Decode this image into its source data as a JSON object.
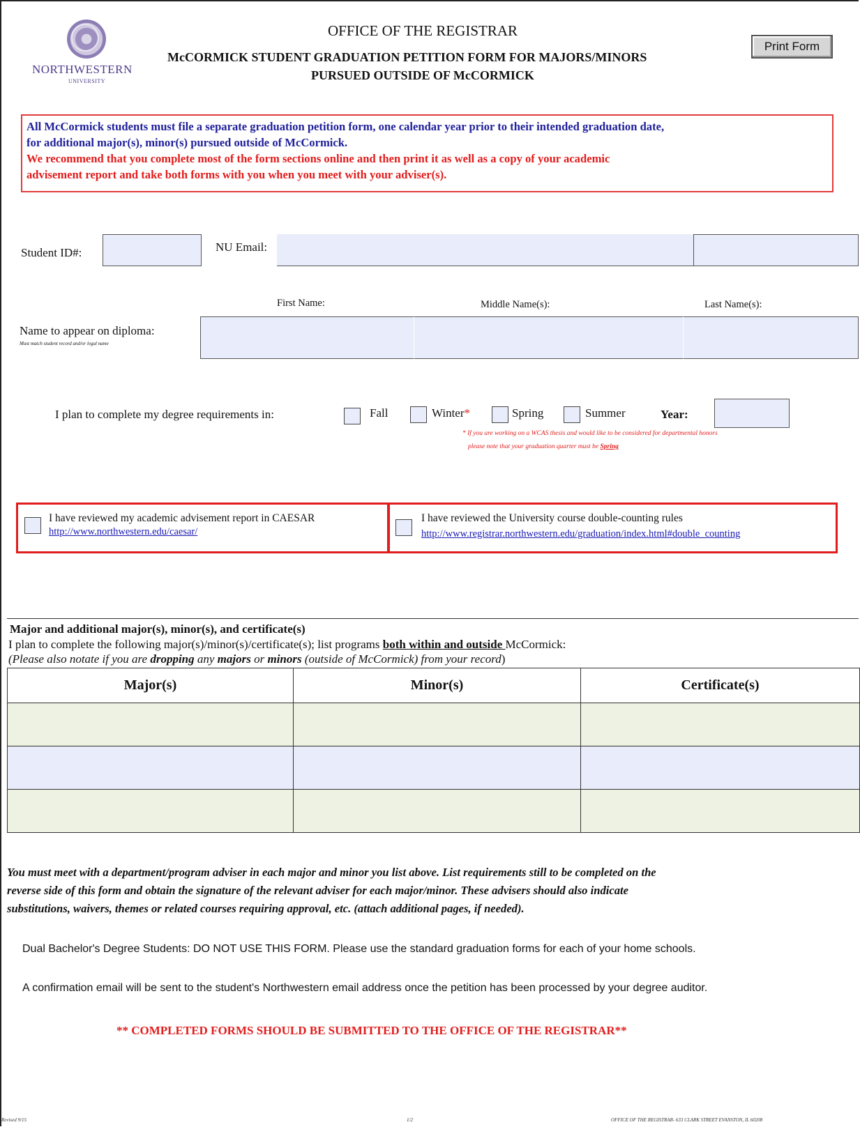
{
  "header": {
    "logo_name": "NORTHWESTERN",
    "logo_sub": "UNIVERSITY",
    "office": "OFFICE OF THE REGISTRAR",
    "title_line1": "McCORMICK STUDENT GRADUATION PETITION FORM FOR MAJORS/MINORS",
    "title_line2": "PURSUED OUTSIDE OF McCORMICK",
    "print_button": "Print Form"
  },
  "notice": {
    "line1": "All McCormick students must file a separate graduation petition form, one calendar year prior to their intended graduation date,",
    "line2": "for additional major(s), minor(s) pursued outside of McCormick.",
    "line3": "We recommend that you complete most of the form sections online and then print it as well as a copy of your academic",
    "line4": "advisement report and take both forms with you when you meet with your adviser(s)."
  },
  "student": {
    "id_label": "Student ID#:",
    "id_value": "",
    "email_label": "NU Email:",
    "email_value": "",
    "email_domain_value": ""
  },
  "diploma": {
    "first_label": "First Name:",
    "middle_label": "Middle Name(s):",
    "last_label": "Last Name(s):",
    "label": "Name to appear on diploma:",
    "sublabel": "Must match student record and/or legal name",
    "first_value": "",
    "middle_value": "",
    "last_value": ""
  },
  "plan": {
    "label": "I plan to complete my degree requirements in:",
    "options": [
      "Fall",
      "Winter",
      "Spring",
      "Summer"
    ],
    "winter_star": "*",
    "year_label": "Year:",
    "year_value": "",
    "note_line1": "* If you are working on a WCAS thesis and would like to be considered for departmental honors",
    "note_line2_a": "please note that your graduation quarter must be ",
    "note_line2_b": "Spring"
  },
  "review": {
    "caesar_text": "I have reviewed my academic advisement report in CAESAR",
    "caesar_link": "http://www.northwestern.edu/caesar/",
    "double_text": "I have reviewed the University course double-counting rules",
    "double_link": "http://www.registrar.northwestern.edu/graduation/index.html#double_counting"
  },
  "programs": {
    "title": "Major and additional major(s), minor(s), and certificate(s)",
    "line_a": "I plan to complete the following major(s)/minor(s)/certificate(s); list programs ",
    "line_b": "both within and outside ",
    "line_c": "McCormick:",
    "note_a": "(Please also notate if you are ",
    "note_b": "dropping",
    "note_c": " any ",
    "note_d": "majors",
    "note_e": " or ",
    "note_f": "minors",
    "note_g": " (outside of McCormick) from your record",
    "note_h": ")",
    "headers": [
      "Major(s)",
      "Minor(s)",
      "Certificate(s)"
    ],
    "rows": [
      [
        "",
        "",
        ""
      ],
      [
        "",
        "",
        ""
      ],
      [
        "",
        "",
        ""
      ]
    ]
  },
  "advice": {
    "line1": "You must meet with a department/program adviser in each major and minor you list above. List requirements still to be completed on the",
    "line2": "reverse side of this form and obtain the signature of the relevant adviser for each major/minor. These advisers should also indicate",
    "line3": "substitutions, waivers, themes or related courses requiring approval, etc. (attach additional pages, if needed)."
  },
  "info": {
    "dual": "Dual Bachelor's Degree Students: DO NOT USE THIS FORM. Please use the standard graduation forms for each of your home schools.",
    "confirm": "A confirmation email will be sent to the student's Northwestern email address once the petition has been processed by your degree auditor.",
    "submit": "** COMPLETED FORMS SHOULD BE SUBMITTED TO THE OFFICE OF THE REGISTRAR**"
  },
  "footer": {
    "revised": "Revised 9/15",
    "page": "1/2",
    "address": "OFFICE OF THE REGISTRAR- 633 CLARK STREET EVANSTON, IL 60208"
  }
}
